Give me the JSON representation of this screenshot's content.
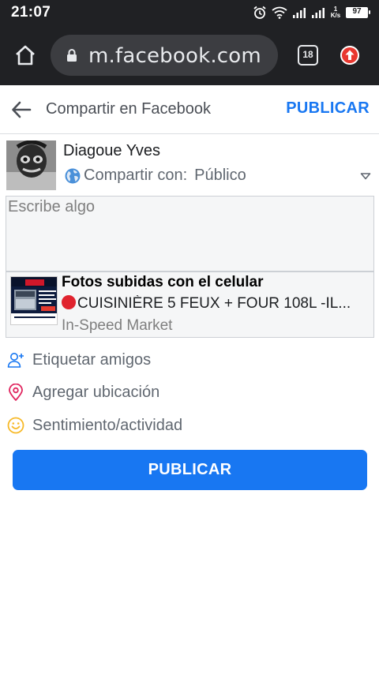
{
  "status_bar": {
    "time": "21:07",
    "net_speed_value": "1",
    "net_speed_unit": "K/s",
    "battery": "97",
    "icons": [
      "alarm-icon",
      "wifi-icon",
      "signal-icon",
      "signal-icon"
    ]
  },
  "browser": {
    "url": "m.facebook.com",
    "tab_count": "18",
    "icons": [
      "home-icon",
      "lock-icon",
      "tab-switcher-icon",
      "update-icon"
    ]
  },
  "header": {
    "title": "Compartir en Facebook",
    "publish_label": "PUBLICAR",
    "back_icon": "arrow-left-icon"
  },
  "profile": {
    "name": "Diagoue Yves",
    "share_label": "Compartir con:",
    "share_value": "Público",
    "globe_icon": "globe-icon",
    "dropdown_icon": "caret-down-icon"
  },
  "composer": {
    "placeholder": "Escribe algo"
  },
  "attachment": {
    "title": "Fotos subidas con el celular",
    "description": "CUISINIÈRE 5 FEUX + FOUR 108L -IL...",
    "source": "In-Speed Market"
  },
  "options": [
    {
      "label": "Etiquetar amigos",
      "icon": "tag-friends-icon"
    },
    {
      "label": "Agregar ubicación",
      "icon": "location-pin-icon"
    },
    {
      "label": "Sentimiento/actividad",
      "icon": "smiley-icon"
    }
  ],
  "publish_button": "PUBLICAR",
  "colors": {
    "brand_blue": "#1877f2",
    "status_bar": "#202124",
    "url_box": "#3c3d41",
    "text_secondary": "#606770",
    "location_pink": "#e0245e",
    "smiley_yellow": "#f7b928",
    "bullet_red": "#e0232e"
  }
}
